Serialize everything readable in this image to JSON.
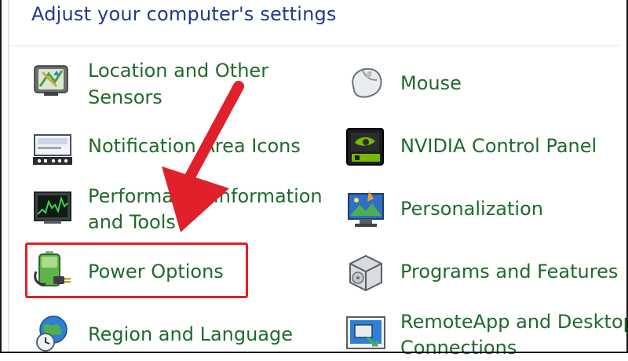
{
  "header": {
    "title": "Adjust your computer's settings"
  },
  "items": {
    "location": {
      "line1": "Location and Other",
      "line2": "Sensors",
      "icon": "gps-device-icon"
    },
    "notification": {
      "line1": "Notification Area Icons",
      "icon": "notification-area-icon"
    },
    "performance": {
      "line1": "Performance Information",
      "line2": "and Tools",
      "icon": "performance-monitor-icon"
    },
    "power": {
      "line1": "Power Options",
      "icon": "battery-plug-icon"
    },
    "region": {
      "line1": "Region and Language",
      "icon": "globe-clock-icon"
    },
    "mouse": {
      "line1": "Mouse",
      "icon": "mouse-icon"
    },
    "nvidia": {
      "line1": "NVIDIA Control Panel",
      "icon": "nvidia-icon"
    },
    "personalization": {
      "line1": "Personalization",
      "icon": "monitor-paint-icon"
    },
    "programs": {
      "line1": "Programs and Features",
      "icon": "programs-box-icon"
    },
    "remoteapp": {
      "line1": "RemoteApp and Desktop",
      "line2": "Connections",
      "icon": "remote-desktop-icon"
    }
  },
  "colors": {
    "header_text": "#1e3a8a",
    "link_text": "#1f6b2a",
    "highlight": "#e0202a"
  }
}
